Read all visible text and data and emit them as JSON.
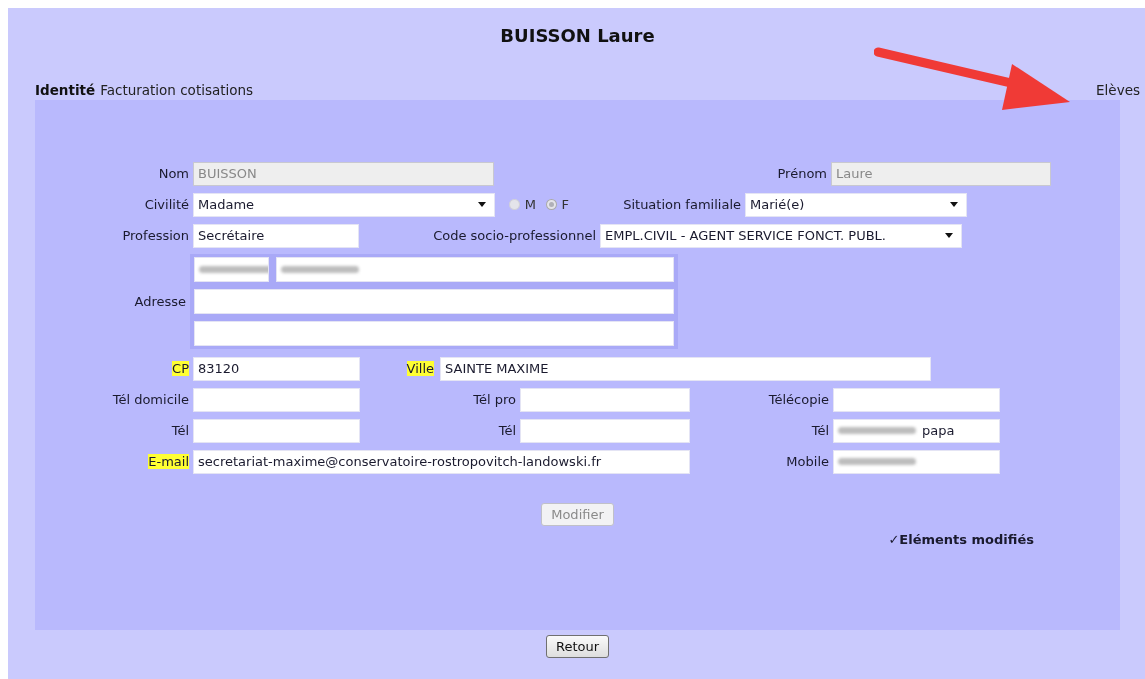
{
  "title": "BUISSON Laure",
  "tabs": [
    {
      "label": "Identité",
      "selected": true
    },
    {
      "label": "Facturation cotisations",
      "selected": false
    },
    {
      "label": "Elèves",
      "selected": false
    }
  ],
  "form": {
    "rows": [
      {
        "kind": "fields",
        "items": [
          {
            "label": "Nom",
            "kind": "text",
            "value": "BUISSON",
            "disabled": true
          },
          {
            "label": "Prénom",
            "kind": "text",
            "value": "Laure",
            "disabled": true
          }
        ]
      },
      {
        "kind": "fields",
        "items": [
          {
            "label": "Civilité",
            "kind": "select",
            "value": "Madame"
          },
          {
            "kind": "radio",
            "options": [
              {
                "label": "M",
                "selected": false
              },
              {
                "label": "F",
                "selected": true
              }
            ]
          },
          {
            "label": "Situation familiale",
            "kind": "select",
            "value": "Marié(e)"
          }
        ]
      },
      {
        "kind": "fields",
        "items": [
          {
            "label": "Profession",
            "kind": "text",
            "value": "Secrétaire"
          },
          {
            "label": "Code socio-professionnel",
            "kind": "select",
            "value": "EMPL.CIVIL - AGENT SERVICE FONCT. PUBL."
          }
        ]
      },
      {
        "kind": "address",
        "label": "Adresse",
        "lines": [
          [
            {
              "redacted": true
            },
            {
              "redacted": true
            }
          ],
          [
            {
              "redacted": false
            }
          ],
          [
            {
              "redacted": false
            }
          ]
        ]
      },
      {
        "kind": "fields",
        "items": [
          {
            "label": "CP",
            "kind": "text",
            "value": "83120",
            "highlighted": true
          },
          {
            "label": "Ville",
            "kind": "text",
            "value": "SAINTE MAXIME",
            "highlighted": true
          }
        ]
      },
      {
        "kind": "fields",
        "items": [
          {
            "label": "Tél domicile",
            "kind": "text"
          },
          {
            "label": "Tél pro",
            "kind": "text"
          },
          {
            "label": "Télécopie",
            "kind": "text"
          }
        ]
      },
      {
        "kind": "fields",
        "items": [
          {
            "label": "Tél",
            "kind": "text"
          },
          {
            "label": "Tél",
            "kind": "text"
          },
          {
            "label": "Tél",
            "kind": "text",
            "value": "papa",
            "redacted": true
          }
        ]
      },
      {
        "kind": "fields",
        "items": [
          {
            "label": "E-mail",
            "kind": "text",
            "value": "secretariat-maxime@conservatoire-rostropovitch-landowski.fr",
            "highlighted": true
          },
          {
            "label": "Mobile",
            "kind": "text",
            "redacted": true
          }
        ]
      }
    ]
  },
  "submit": {
    "label": "Modifier",
    "disabled": true
  },
  "status": {
    "mark": "✓",
    "text": "Eléments modifiés"
  },
  "back": {
    "label": "Retour"
  }
}
